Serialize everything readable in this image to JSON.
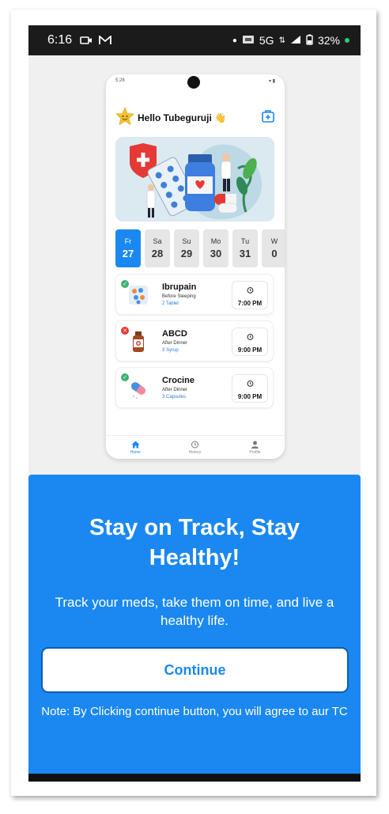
{
  "status_bar": {
    "time": "6:16",
    "network": "5G",
    "battery": "32%",
    "icons": [
      "video-icon",
      "gmail-icon",
      "dot-icon",
      "sim-icon",
      "signal-icon",
      "battery-icon"
    ]
  },
  "preview": {
    "status_time": "5:28",
    "greeting": "Hello Tubeguruji",
    "greeting_emoji": "👋",
    "days": [
      {
        "name": "Fr",
        "date": "27",
        "active": true
      },
      {
        "name": "Sa",
        "date": "28"
      },
      {
        "name": "Su",
        "date": "29"
      },
      {
        "name": "Mo",
        "date": "30"
      },
      {
        "name": "Tu",
        "date": "31"
      },
      {
        "name": "W",
        "date": "0"
      }
    ],
    "medications": [
      {
        "name": "Ibrupain",
        "when": "Before Sleeping",
        "dose": "2 Tablet",
        "time": "7:00 PM",
        "status": "taken"
      },
      {
        "name": "ABCD",
        "when": "After Dinner",
        "dose": "3 Syrup",
        "time": "9:00 PM",
        "status": "missed"
      },
      {
        "name": "Crocine",
        "when": "After Dinner",
        "dose": "3 Capsules",
        "time": "9:00 PM",
        "status": "taken"
      }
    ],
    "nav": [
      {
        "label": "Home",
        "icon": "home-icon"
      },
      {
        "label": "History",
        "icon": "history-icon"
      },
      {
        "label": "Profile",
        "icon": "profile-icon"
      }
    ]
  },
  "promo": {
    "headline": "Stay on Track, Stay Healthy!",
    "description": "Track your meds, take them on time, and live a healthy life.",
    "continue_label": "Continue",
    "note": "Note: By Clicking continue button, you will agree to aur TC"
  },
  "colors": {
    "accent": "#1a88f0",
    "status_bar": "#1b1b1b",
    "taken": "#3cb371",
    "missed": "#e53935"
  }
}
